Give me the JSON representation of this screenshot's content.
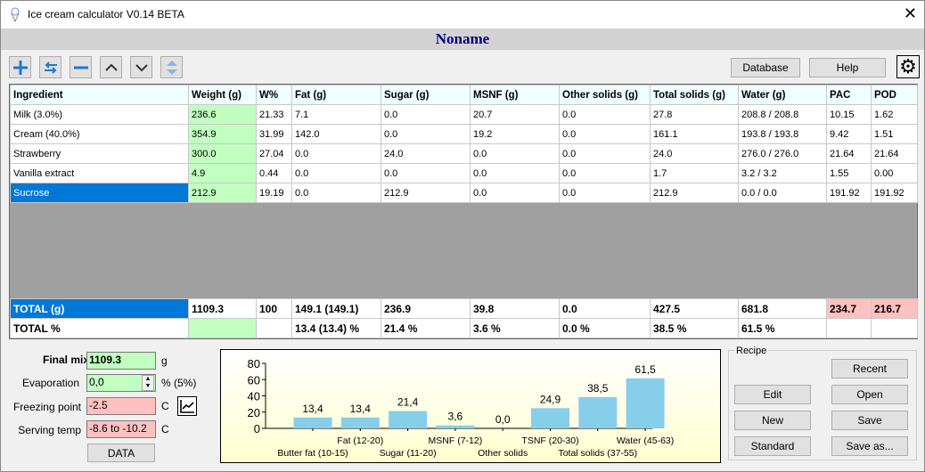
{
  "window": {
    "title": "Ice cream calculator  V0.14 BETA",
    "close": "✕"
  },
  "recipe_name": "Noname",
  "toolbar": {
    "database": "Database",
    "help": "Help"
  },
  "table": {
    "headers": [
      "Ingredient",
      "Weight (g)",
      "W%",
      "Fat (g)",
      "Sugar (g)",
      "MSNF (g)",
      "Other solids (g)",
      "Total solids (g)",
      "Water (g)",
      "PAC",
      "POD"
    ],
    "rows": [
      [
        "Milk (3.0%)",
        "236.6",
        "21.33",
        "7.1",
        "0.0",
        "20.7",
        "0.0",
        "27.8",
        "208.8 / 208.8",
        "10.15",
        "1.62"
      ],
      [
        "Cream (40.0%)",
        "354.9",
        "31.99",
        "142.0",
        "0.0",
        "19.2",
        "0.0",
        "161.1",
        "193.8 / 193.8",
        "9.42",
        "1.51"
      ],
      [
        "Strawberry",
        "300.0",
        "27.04",
        "0.0",
        "24.0",
        "0.0",
        "0.0",
        "24.0",
        "276.0 / 276.0",
        "21.64",
        "21.64"
      ],
      [
        "Vanilla extract",
        "4.9",
        "0.44",
        "0.0",
        "0.0",
        "0.0",
        "0.0",
        "1.7",
        "3.2 / 3.2",
        "1.55",
        "0.00"
      ],
      [
        "Sucrose",
        "212.9",
        "19.19",
        "0.0",
        "212.9",
        "0.0",
        "0.0",
        "212.9",
        "0.0 / 0.0",
        "191.92",
        "191.92"
      ]
    ],
    "selected_row": 4,
    "total_g": [
      "TOTAL (g)",
      "1109.3",
      "100",
      "149.1 (149.1)",
      "236.9",
      "39.8",
      "0.0",
      "427.5",
      "681.8",
      "234.7",
      "216.7"
    ],
    "total_pct": [
      "TOTAL %",
      "",
      "",
      "13.4 (13.4) %",
      "21.4 %",
      "3.6 %",
      "0.0 %",
      "38.5 %",
      "61.5 %",
      "",
      ""
    ]
  },
  "mix": {
    "final_mix_label": "Final mix",
    "final_mix": "1109.3",
    "final_unit": "g",
    "evap_label": "Evaporation",
    "evap": "0,0",
    "evap_unit": "% (5%)",
    "fp_label": "Freezing point",
    "fp": "-2.5",
    "fp_unit": "C",
    "serve_label": "Serving temp",
    "serve": "-8.6 to -10.2",
    "serve_unit": "C",
    "data_btn": "DATA"
  },
  "recipe": {
    "title": "Recipe",
    "recent": "Recent",
    "edit": "Edit",
    "open": "Open",
    "new": "New",
    "save": "Save",
    "standard": "Standard",
    "save_as": "Save as..."
  },
  "chart_data": {
    "type": "bar",
    "categories": [
      "Butter fat (10-15)",
      "Fat (12-20)",
      "Sugar (11-20)",
      "MSNF (7-12)",
      "Other solids",
      "TSNF (20-30)",
      "Total solids (37-55)",
      "Water (45-63)"
    ],
    "values": [
      13.4,
      13.4,
      21.4,
      3.6,
      0.0,
      24.9,
      38.5,
      61.5
    ],
    "labels": [
      "13,4",
      "13,4",
      "21,4",
      "3,6",
      "0,0",
      "24,9",
      "38,5",
      "61,5"
    ],
    "yticks": [
      "0",
      "20",
      "40",
      "60",
      "80"
    ],
    "ylim": [
      0,
      80
    ],
    "color": "#87ceeb"
  }
}
